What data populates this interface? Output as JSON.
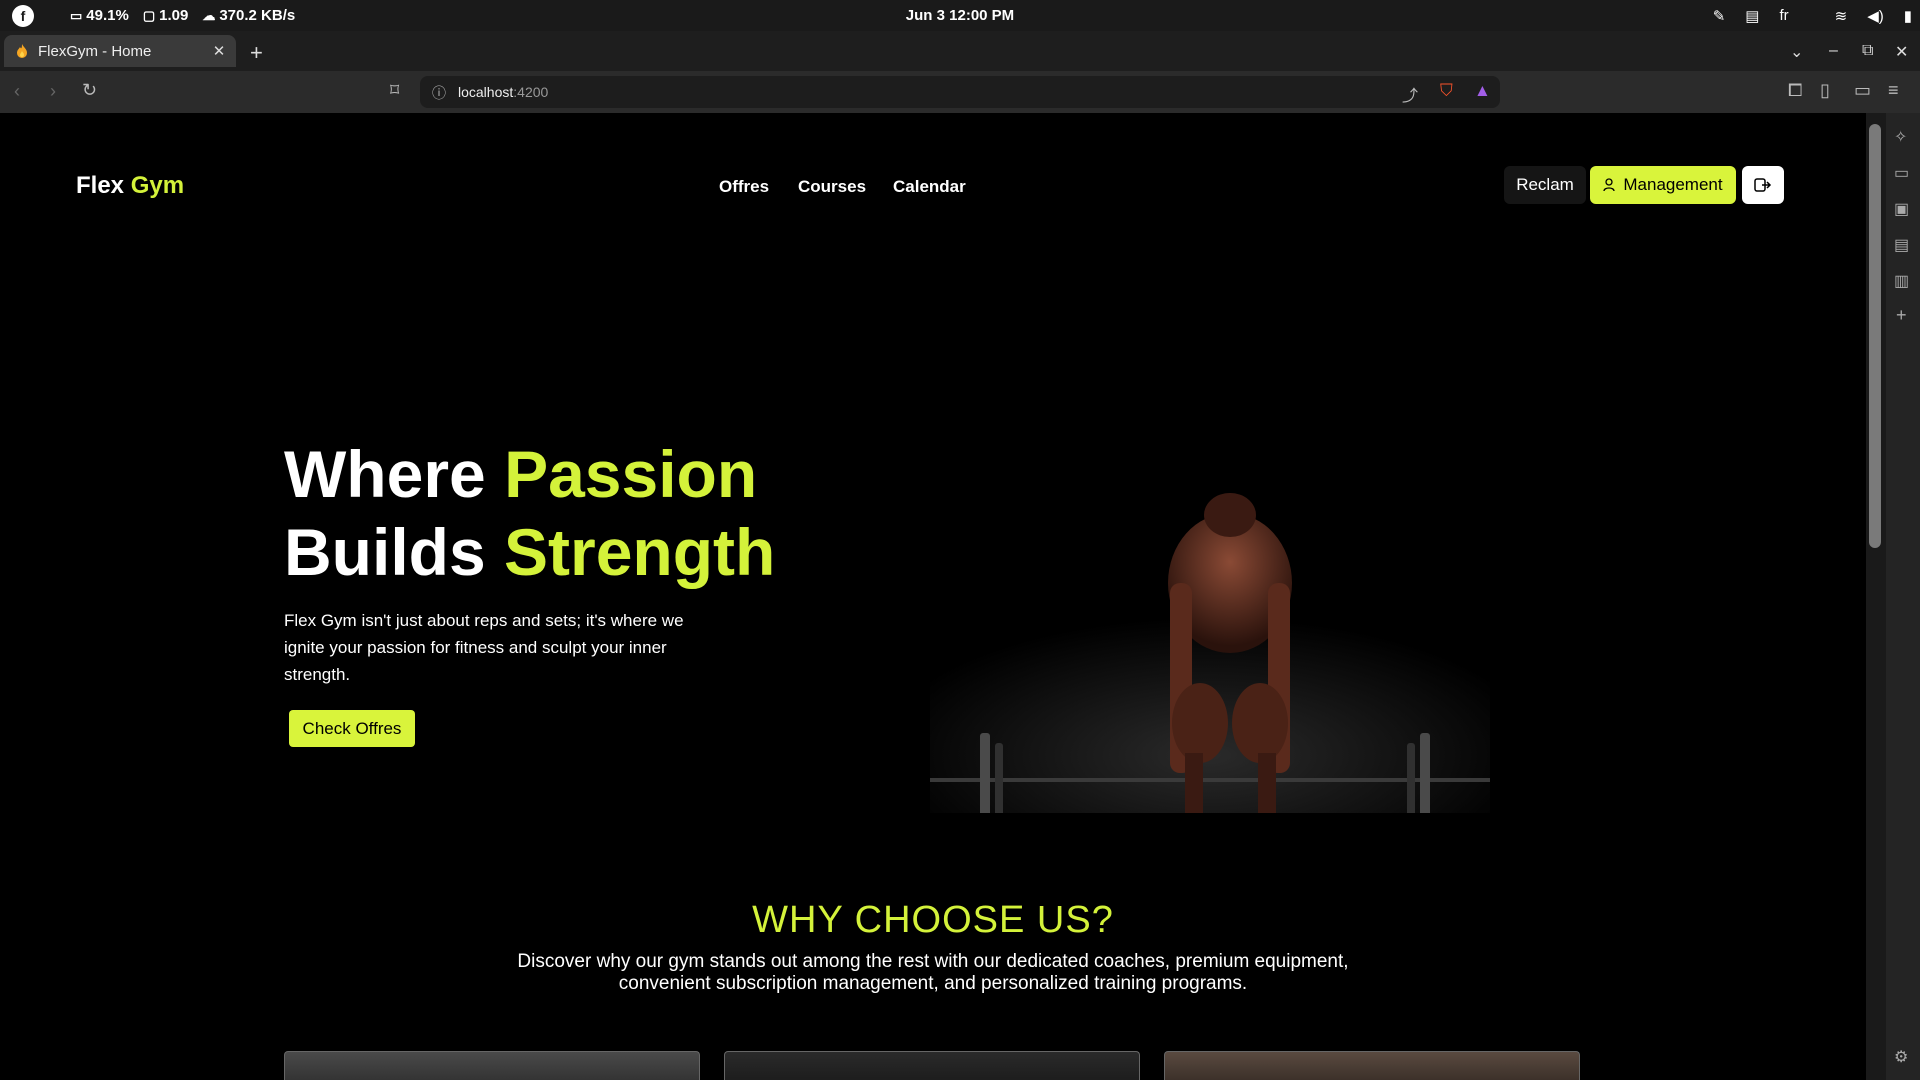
{
  "system_bar": {
    "battery": "49.1%",
    "load": "1.09",
    "network": "370.2 KB/s",
    "datetime": "Jun 3  12:00 PM",
    "language": "fr"
  },
  "browser": {
    "tab_title": "FlexGym - Home",
    "url_host": "localhost",
    "url_port": ":4200"
  },
  "site": {
    "logo_part1": "Flex",
    "logo_part2": "Gym",
    "nav": [
      "Offres",
      "Courses",
      "Calendar"
    ],
    "reclam_label": "Reclam",
    "management_label": "Management",
    "hero": {
      "line1_a": "Where",
      "line1_b": "Passion",
      "line2_a": "Builds",
      "line2_b": "Strength",
      "text": "Flex Gym isn't just about reps and sets; it's where we ignite your passion for fitness and sculpt your inner strength.",
      "button": "Check Offres"
    },
    "why": {
      "title": "WHY CHOOSE US?",
      "subtitle": "Discover why our gym stands out among the rest with our dedicated coaches, premium equipment, convenient subscription management, and personalized training programs."
    }
  },
  "colors": {
    "accent": "#d4f23a",
    "background": "#000000"
  }
}
